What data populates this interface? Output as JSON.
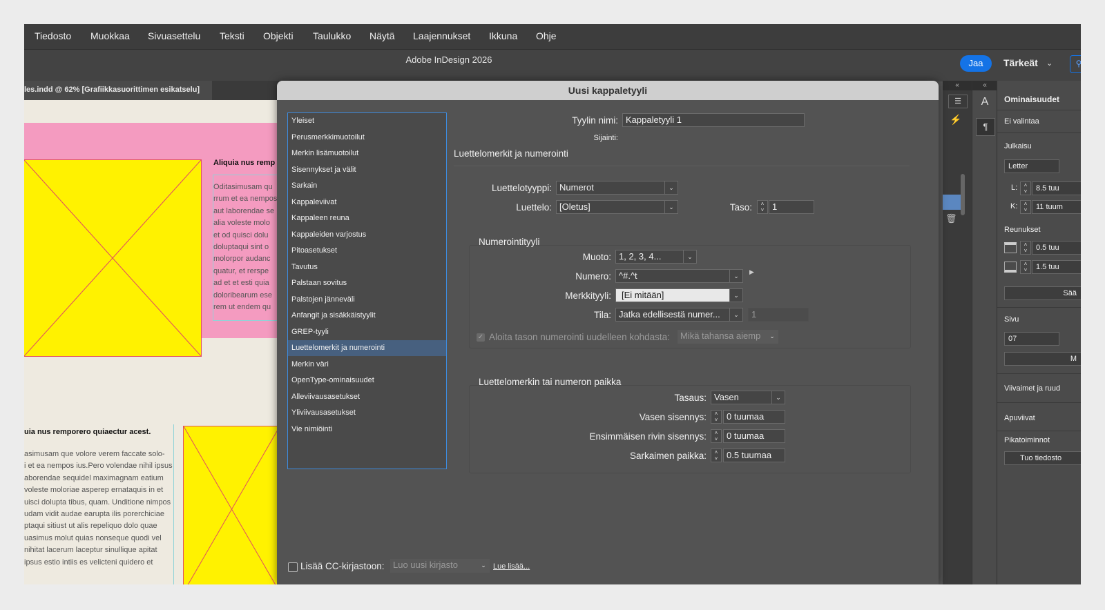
{
  "menu": [
    "Tiedosto",
    "Muokkaa",
    "Sivuasettelu",
    "Teksti",
    "Objekti",
    "Taulukko",
    "Näytä",
    "Laajennukset",
    "Ikkuna",
    "Ohje"
  ],
  "titlebar": {
    "app_title": "Adobe InDesign 2026",
    "share_label": "Jaa",
    "workspace_label": "Tärkeät"
  },
  "document": {
    "tab_label": "les.indd @ 62% [Grafiikkasuorittimen esikatselu]"
  },
  "canvas": {
    "caption1": "Aliquia nus remp",
    "body1": [
      "Oditasimusam qu",
      "rrum et ea nempos",
      "aut laborendae se",
      "alia voleste molo",
      "et od quisci dolu",
      "doluptaqui sint o",
      "molorpor audanc",
      "quatur, et rerspe",
      "ad et et esti quia",
      "doloribearum ese",
      "rem ut endem qu"
    ],
    "caption2": "uia nus remporero quiaectur acest.",
    "body2": [
      "asimusam que volore verem faccate solo-",
      "i et ea nempos ius.Pero volendae nihil ipsus",
      "aborendae sequidel maximagnam eatium",
      "voleste moloriae asperep ernataquis in et",
      "uisci dolupta tibus, quam. Unditione nimpos",
      "udam vidit audae earupta ilis porerchiciae",
      "ptaqui sitiust ut alis repeliquo dolo quae",
      "uasimus molut quias nonseque quodi vel",
      "nihitat lacerum laceptur sinullique apitat",
      "ipsus estio intiis es velicteni quidero et"
    ]
  },
  "dialog": {
    "title": "Uusi kappaletyyli",
    "categories": [
      "Yleiset",
      "Perusmerkkimuotoilut",
      "Merkin lisämuotoilut",
      "Sisennykset ja välit",
      "Sarkain",
      "Kappaleviivat",
      "Kappaleen reuna",
      "Kappaleiden varjostus",
      "Pitoasetukset",
      "Tavutus",
      "Palstaan sovitus",
      "Palstojen jänneväli",
      "Anfangit ja sisäkkäistyylit",
      "GREP-tyyli",
      "Luettelomerkit ja numerointi",
      "Merkin väri",
      "OpenType-ominaisuudet",
      "Alleviivausasetukset",
      "Yliviivausasetukset",
      "Vie nimiöinti"
    ],
    "selected_category": "Luettelomerkit ja numerointi",
    "style_name_label": "Tyylin nimi:",
    "style_name_value": "Kappaletyyli 1",
    "location_label": "Sijainti:",
    "section_title": "Luettelomerkit ja numerointi",
    "list_type_label": "Luettelotyyppi:",
    "list_type_value": "Numerot",
    "list_label": "Luettelo:",
    "list_value": "[Oletus]",
    "level_label": "Taso:",
    "level_value": "1",
    "numbering_style": {
      "title": "Numerointityyli",
      "format_label": "Muoto:",
      "format_value": "1, 2, 3, 4...",
      "number_label": "Numero:",
      "number_value": "^#.^t",
      "char_style_label": "Merkkityyli:",
      "char_style_value": "[Ei mitään]",
      "mode_label": "Tila:",
      "mode_value": "Jatka edellisestä numer...",
      "mode_number": "1",
      "restart_label": "Aloita tason numerointi uudelleen kohdasta:",
      "restart_value": "Mikä tahansa aiemp"
    },
    "position": {
      "title": "Luettelomerkin tai numeron paikka",
      "align_label": "Tasaus:",
      "align_value": "Vasen",
      "left_indent_label": "Vasen sisennys:",
      "left_indent_value": "0 tuumaa",
      "first_line_label": "Ensimmäisen rivin sisennys:",
      "first_line_value": "0 tuumaa",
      "tab_pos_label": "Sarkaimen paikka:",
      "tab_pos_value": "0.5 tuumaa"
    },
    "cc_label": "Lisää CC-kirjastoon:",
    "cc_library": "Luo uusi kirjasto",
    "learn_more": "Lue lisää..."
  },
  "properties": {
    "title": "Ominaisuudet",
    "no_selection": "Ei valintaa",
    "publication": "Julkaisu",
    "page_size": "Letter",
    "w_label": "L:",
    "w_value": "8.5 tuu",
    "h_label": "K:",
    "h_value": "11 tuum",
    "margins": "Reunukset",
    "margin_top": "0.5 tuu",
    "margin_bottom": "1.5 tuu",
    "adjust_btn": "Sää",
    "page": "Sivu",
    "page_value": "07",
    "page_btn": "M",
    "rulers": "Viivaimet ja ruud",
    "guides": "Apuviivat",
    "quick_actions": "Pikatoiminnot",
    "import_btn": "Tuo tiedosto"
  },
  "colors": {
    "accent": "#1473e6",
    "selection": "#47607f",
    "pink": "#f49bc0",
    "placeholder": "#fff200"
  }
}
